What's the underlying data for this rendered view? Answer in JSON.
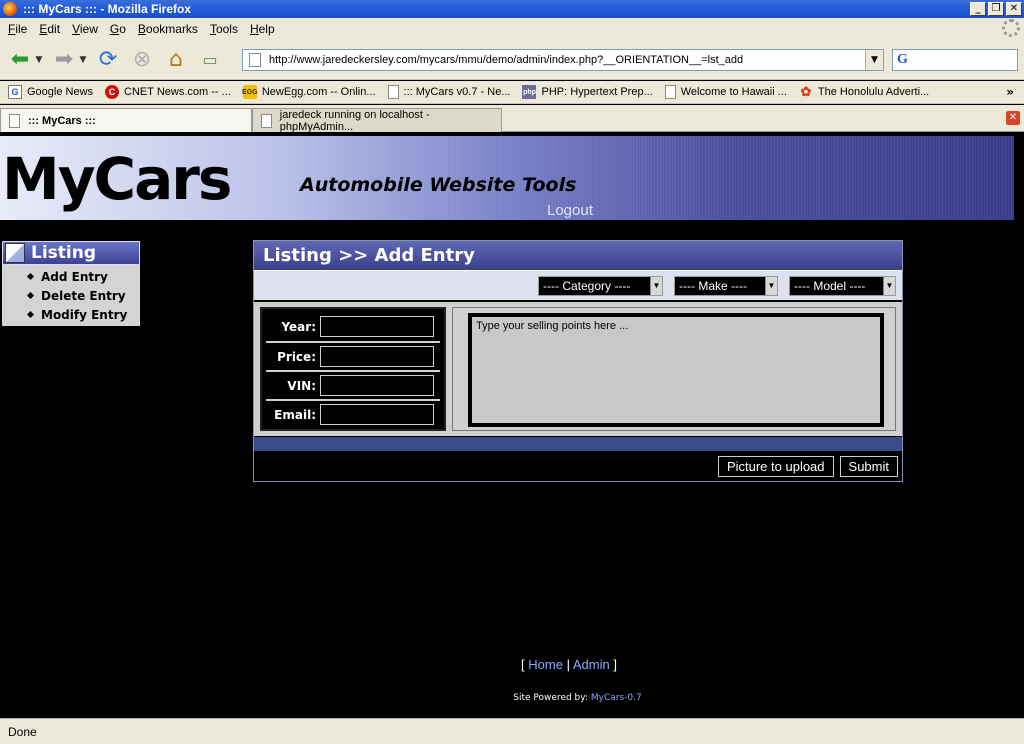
{
  "window": {
    "title": "::: MyCars ::: - Mozilla Firefox"
  },
  "menu": [
    "File",
    "Edit",
    "View",
    "Go",
    "Bookmarks",
    "Tools",
    "Help"
  ],
  "address": {
    "url": "http://www.jaredeckersley.com/mycars/mmu/demo/admin/index.php?__ORIENTATION__=lst_add"
  },
  "bookmarks": [
    "Google News",
    "CNET News.com -- ...",
    "NewEgg.com -- Onlin...",
    "::: MyCars v0.7 - Ne...",
    "PHP: Hypertext Prep...",
    "Welcome to Hawaii ...",
    "The Honolulu Adverti..."
  ],
  "tabs": [
    {
      "label": "::: MyCars :::"
    },
    {
      "label": "jaredeck running on localhost - phpMyAdmin..."
    }
  ],
  "site": {
    "logo": "MyCars",
    "tagline": "Automobile Website Tools",
    "logout": "Logout"
  },
  "sidebar": {
    "title": "Listing",
    "items": [
      "Add Entry",
      "Delete Entry",
      "Modify Entry"
    ]
  },
  "panel": {
    "title": "Listing >> Add Entry",
    "selects": {
      "category": "---- Category ----",
      "make": "---- Make ----",
      "model": "---- Model ----"
    },
    "fields": {
      "year": "Year:",
      "price": "Price:",
      "vin": "VIN:",
      "email": "Email:"
    },
    "selling_points_placeholder": "Type your selling points here ...",
    "buttons": {
      "upload": "Picture to upload",
      "submit": "Submit"
    }
  },
  "footer": {
    "open_bracket": "[",
    "home": "Home",
    "sep": "|",
    "admin": "Admin",
    "close_bracket": "]",
    "powered_label": "Site Powered by:",
    "powered_version": "MyCars-0.7"
  },
  "status": "Done"
}
